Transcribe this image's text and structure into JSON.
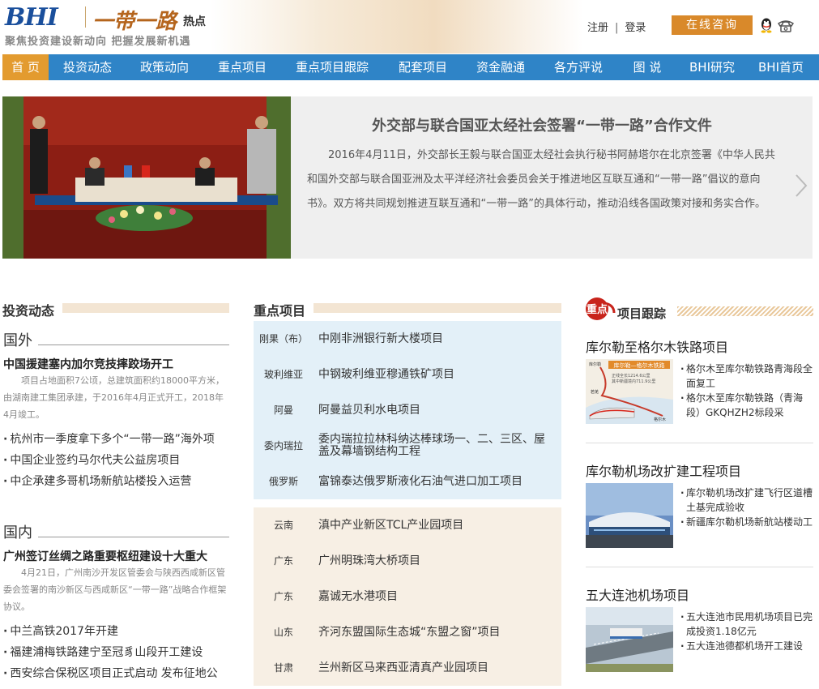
{
  "header": {
    "logo_text": "BHI",
    "brand": "一带一路",
    "brand_suffix": "热点",
    "tagline": "聚焦投资建设新动向 把握发展新机遇",
    "register": "注册",
    "divider": "|",
    "login": "登录",
    "consult_button": "在线咨询",
    "qq_icon": "qq-penguin-icon",
    "phone_icon": "phone-icon"
  },
  "nav": {
    "items": [
      "首 页",
      "投资动态",
      "政策动向",
      "重点项目",
      "重点项目跟踪",
      "配套项目",
      "资金融通",
      "各方评说",
      "图 说",
      "BHI研究",
      "BHI首页"
    ],
    "active_index": 0,
    "bg_color": "#2f84c7",
    "active_color": "#e39b2f"
  },
  "banner": {
    "title": "外交部与联合国亚太经社会签署“一带一路”合作文件",
    "text": "2016年4月11日，外交部长王毅与联合国亚太经社会执行秘书阿赫塔尔在北京签署《中华人民共和国外交部与联合国亚洲及太平洋经济社会委员会关于推进地区互联互通和“一带一路”倡议的意向书》。双方将共同规划推进互联互通和“一带一路”的具体行动，推动沿线各国政策对接和务实合作。",
    "next_icon": "chevron-right-icon"
  },
  "investment": {
    "heading": "投资动态",
    "foreign": {
      "label": "国外",
      "lead_title": "中国援建塞内加尔竞技摔跤场开工",
      "lead_desc": "项目占地面积7公顷，总建筑面积约18000平方米，由湖南建工集团承建，于2016年4月正式开工，2018年4月竣工。",
      "items": [
        "杭州市一季度拿下多个“一带一路”海外项",
        "中国企业签约马尔代夫公益房项目",
        "中企承建多哥机场新航站楼投入运营"
      ]
    },
    "domestic": {
      "label": "国内",
      "lead_title": "广州签订丝绸之路重要枢纽建设十大重大",
      "lead_desc": "4月21日，广州南沙开发区管委会与陕西西咸新区管委会签署的南沙新区与西咸新区“一带一路”战略合作框架协议。",
      "items": [
        "中兰高铁2017年开建",
        "福建浦梅铁路建宁至冠豸山段开工建设",
        "西安综合保税区项目正式启动 发布征地公"
      ]
    }
  },
  "projects": {
    "heading": "重点项目",
    "foreign": [
      {
        "region": "刚果（布）",
        "name": "中刚非洲银行新大楼项目"
      },
      {
        "region": "玻利维亚",
        "name": "中钢玻利维亚穆通铁矿项目"
      },
      {
        "region": "阿曼",
        "name": "阿曼益贝利水电项目"
      },
      {
        "region": "委内瑞拉",
        "name": "委内瑞拉拉林科纳达棒球场一、二、三区、屋盖及幕墙钢结构工程"
      },
      {
        "region": "俄罗斯",
        "name": "富锦泰达俄罗斯液化石油气进口加工项目"
      }
    ],
    "domestic": [
      {
        "region": "云南",
        "name": "滇中产业新区TCL产业园项目"
      },
      {
        "region": "广东",
        "name": "广州明珠湾大桥项目"
      },
      {
        "region": "广东",
        "name": "嘉诚无水港项目"
      },
      {
        "region": "山东",
        "name": "齐河东盟国际生态城“东盟之窗”项目"
      },
      {
        "region": "甘肃",
        "name": "兰州新区马来西亚清真产业园项目"
      }
    ]
  },
  "tracking": {
    "badge": "重点",
    "heading": "项目跟踪",
    "sections": [
      {
        "title": "库尔勒至格尔木铁路项目",
        "image_label": "库尔勒—格尔木铁路",
        "image_lines": [
          "正线全长1214.6公里",
          "其中新疆境内711.9公里"
        ],
        "image_places": [
          "库尔勒",
          "若羌",
          "格尔木"
        ],
        "items": [
          "格尔木至库尔勒铁路青海段全面复工",
          "格尔木至库尔勒铁路（青海段）GKQHZH2标段采"
        ]
      },
      {
        "title": "库尔勒机场改扩建工程项目",
        "items": [
          "库尔勒机场改扩建飞行区道槽土基完成验收",
          "新疆库尔勒机场新航站楼动工"
        ]
      },
      {
        "title": "五大连池机场项目",
        "items": [
          "五大连池市民用机场项目已完成投资1.18亿元",
          "五大连池德都机场开工建设"
        ]
      }
    ]
  }
}
